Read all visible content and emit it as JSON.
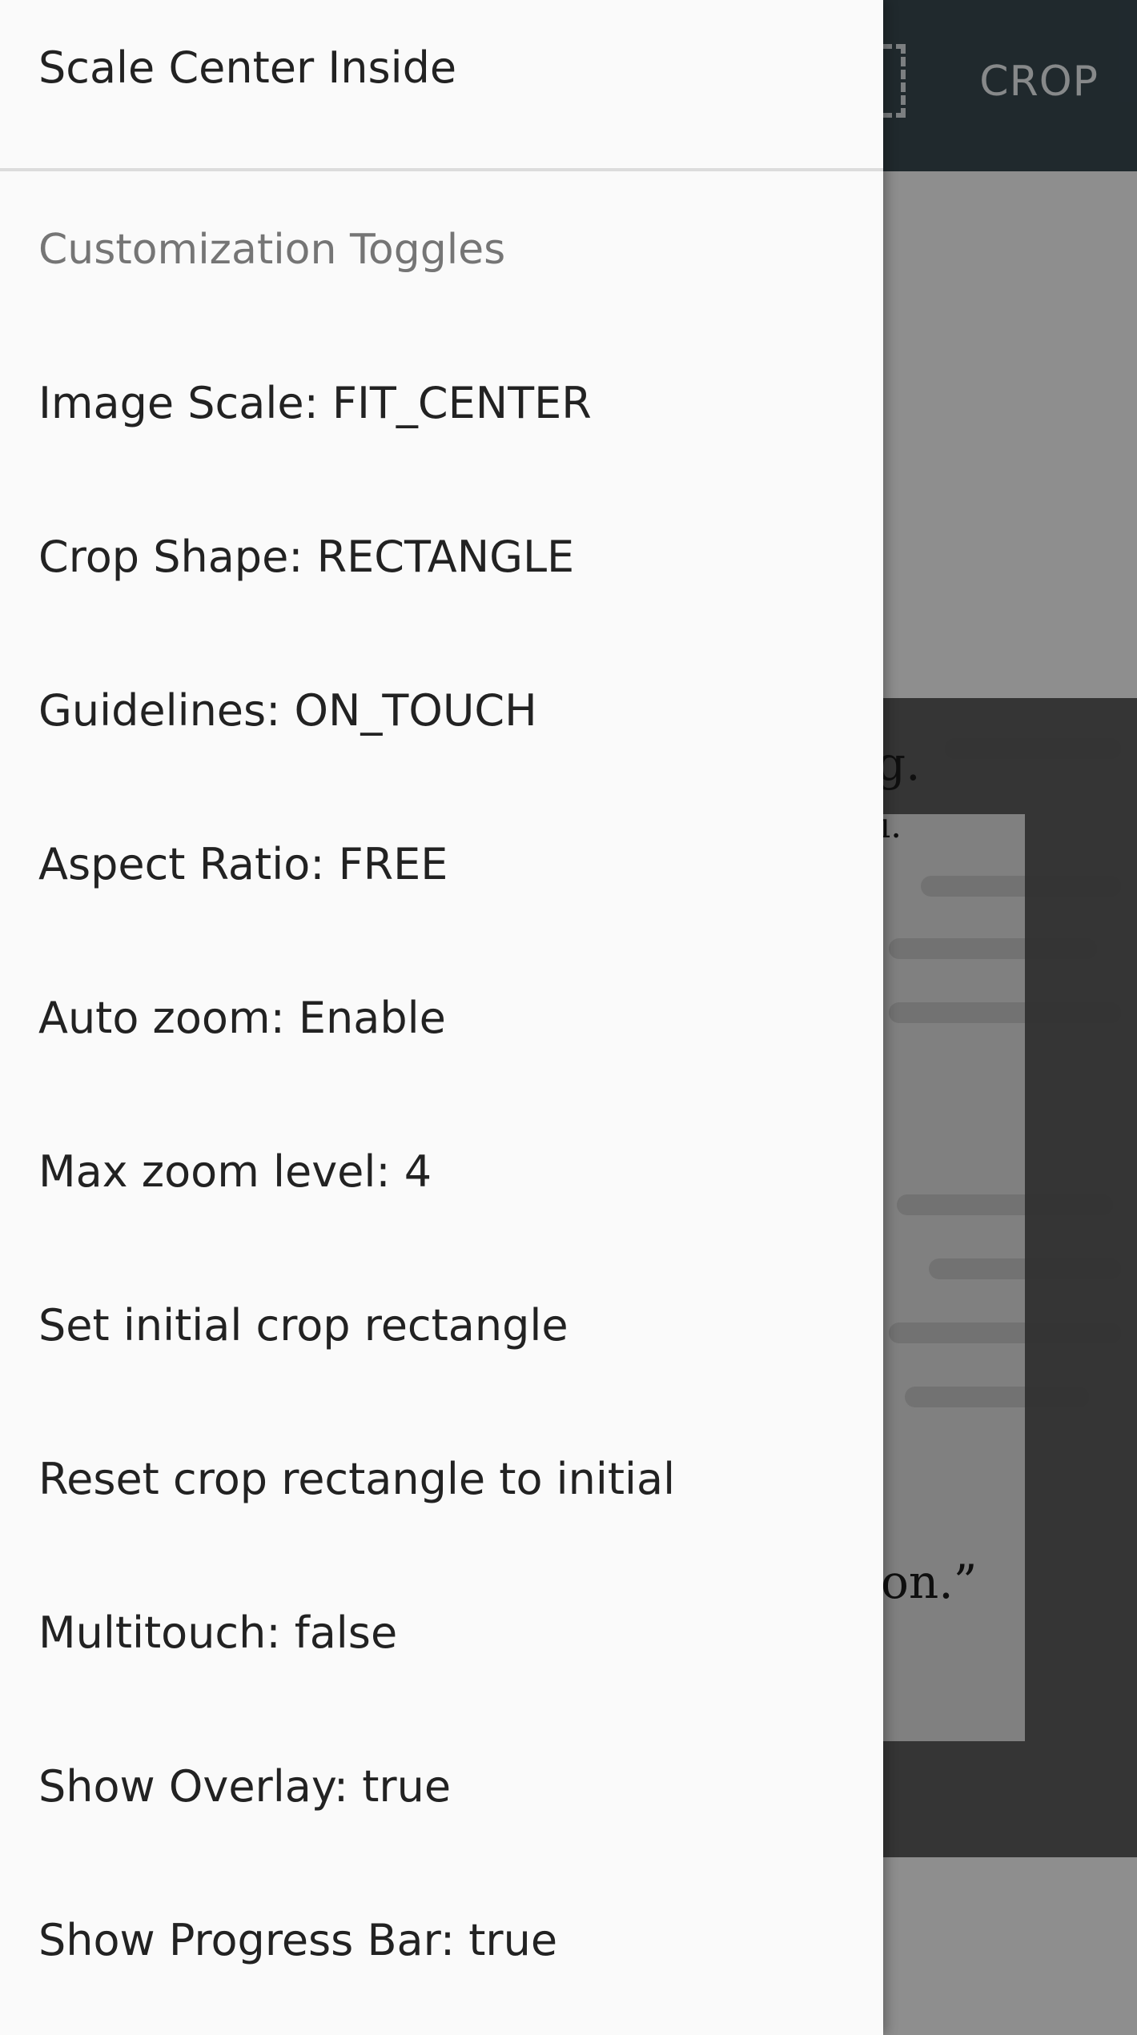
{
  "app_bar": {
    "crop_action": "CROP",
    "crop_icon": "crop-frame-icon",
    "background_color": "#37474f"
  },
  "background_page": {
    "text_1": "g.",
    "text_2": "ı.",
    "text_3": "on.”"
  },
  "drawer": {
    "top_item": "Scale Center Inside",
    "section_header": "Customization Toggles",
    "items": [
      "Image Scale: FIT_CENTER",
      "Crop Shape: RECTANGLE",
      "Guidelines: ON_TOUCH",
      "Aspect Ratio: FREE",
      "Auto zoom: Enable",
      "Max zoom level: 4",
      "Set initial crop rectangle",
      "Reset crop rectangle to initial",
      "Multitouch: false",
      "Show Overlay: true",
      "Show Progress Bar: true"
    ]
  }
}
